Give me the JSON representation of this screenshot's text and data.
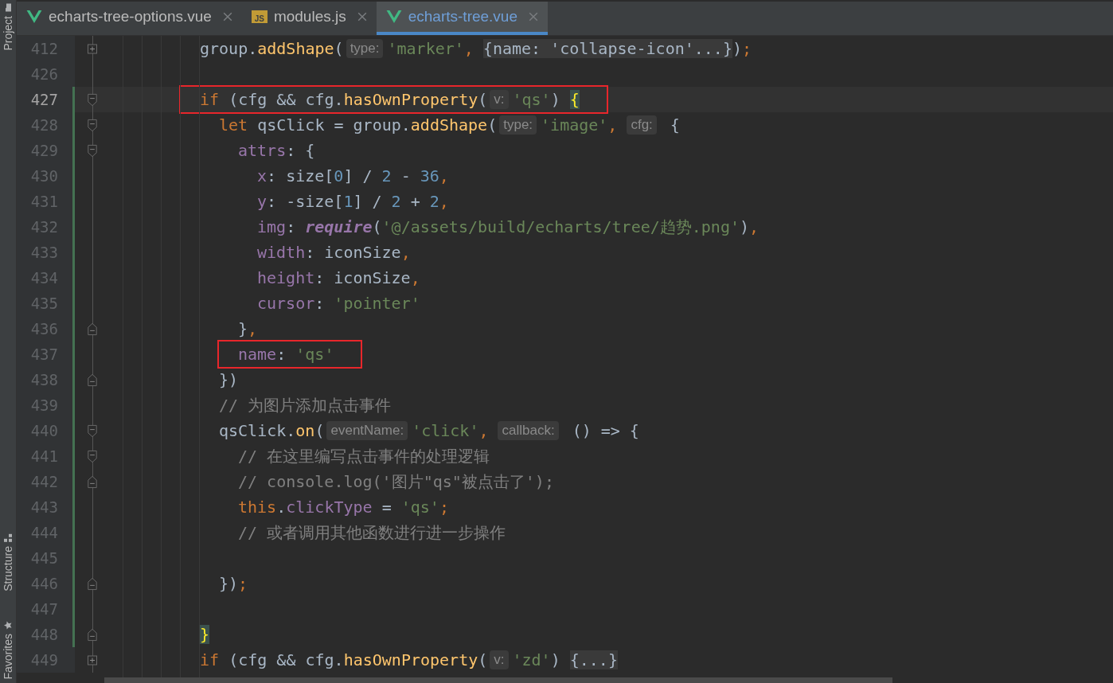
{
  "side_tabs": [
    {
      "label": "Project",
      "kind": "folder"
    },
    {
      "label": "Structure",
      "kind": "structure"
    },
    {
      "label": "Favorites",
      "kind": "star"
    }
  ],
  "tabs": [
    {
      "label": "echarts-tree-options.vue",
      "kind": "vue",
      "selected": false
    },
    {
      "label": "modules.js",
      "kind": "js",
      "icon_text": "JS",
      "selected": false
    },
    {
      "label": "echarts-tree.vue",
      "kind": "vue",
      "selected": true
    }
  ],
  "lines": [
    {
      "number": "412",
      "kind": "fold-plus",
      "changed": false,
      "current": false,
      "boxed": false,
      "tokens": [
        {
          "kind": "plain",
          "t": "group."
        },
        {
          "kind": "fn",
          "t": "addShape"
        },
        {
          "kind": "plain",
          "t": "("
        },
        {
          "kind": "hint",
          "t": "type:"
        },
        {
          "kind": "str",
          "t": "'marker'"
        },
        {
          "kind": "op",
          "t": ","
        },
        {
          "kind": "folded",
          "t": "{name: 'collapse-icon'...}"
        },
        {
          "kind": "plain",
          "t": ")"
        },
        {
          "kind": "op",
          "t": ";"
        }
      ]
    },
    {
      "number": "426",
      "changed": false,
      "current": false,
      "boxed": false
    },
    {
      "number": "427",
      "kind": "fold-open",
      "changed": true,
      "current": true,
      "boxed": true,
      "tokens": [
        {
          "kind": "kw",
          "t": "if"
        },
        {
          "kind": "plain",
          "t": " (cfg && cfg."
        },
        {
          "kind": "fn",
          "t": "hasOwnProperty"
        },
        {
          "kind": "plain",
          "t": "("
        },
        {
          "kind": "hint",
          "t": "v:"
        },
        {
          "kind": "str",
          "t": "'qs'"
        },
        {
          "kind": "plain",
          "t": ")"
        },
        {
          "kind": "brace",
          "t": "{"
        }
      ],
      "children": [
        {
          "number": "428",
          "kind": "fold-open",
          "changed": true,
          "current": false,
          "boxed": false,
          "tokens": [
            {
              "kind": "kw",
              "t": "let"
            },
            {
              "kind": "plain",
              "t": " qsClick = group."
            },
            {
              "kind": "fn",
              "t": "addShape"
            },
            {
              "kind": "plain",
              "t": "("
            },
            {
              "kind": "hint",
              "t": "type:"
            },
            {
              "kind": "str",
              "t": "'image'"
            },
            {
              "kind": "op",
              "t": ","
            },
            {
              "kind": "hint",
              "t": "cfg:"
            },
            {
              "kind": "plain",
              "t": "{"
            }
          ],
          "children": [
            {
              "number": "429",
              "kind": "fold-open",
              "changed": true,
              "current": false,
              "boxed": false,
              "tokens": [
                {
                  "kind": "prop",
                  "t": "attrs"
                },
                {
                  "kind": "plain",
                  "t": ": {"
                }
              ],
              "children": [
                {
                  "number": "430",
                  "changed": true,
                  "current": false,
                  "boxed": false,
                  "tokens": [
                    {
                      "kind": "prop",
                      "t": "x"
                    },
                    {
                      "kind": "plain",
                      "t": ": size["
                    },
                    {
                      "kind": "num",
                      "t": "0"
                    },
                    {
                      "kind": "plain",
                      "t": "] / "
                    },
                    {
                      "kind": "num",
                      "t": "2"
                    },
                    {
                      "kind": "plain",
                      "t": " - "
                    },
                    {
                      "kind": "num",
                      "t": "36"
                    },
                    {
                      "kind": "op",
                      "t": ","
                    }
                  ]
                },
                {
                  "number": "431",
                  "changed": true,
                  "current": false,
                  "boxed": false,
                  "tokens": [
                    {
                      "kind": "prop",
                      "t": "y"
                    },
                    {
                      "kind": "plain",
                      "t": ": -size["
                    },
                    {
                      "kind": "num",
                      "t": "1"
                    },
                    {
                      "kind": "plain",
                      "t": "] / "
                    },
                    {
                      "kind": "num",
                      "t": "2"
                    },
                    {
                      "kind": "plain",
                      "t": " + "
                    },
                    {
                      "kind": "num",
                      "t": "2"
                    },
                    {
                      "kind": "op",
                      "t": ","
                    }
                  ]
                },
                {
                  "number": "432",
                  "changed": true,
                  "current": false,
                  "boxed": false,
                  "tokens": [
                    {
                      "kind": "prop",
                      "t": "img"
                    },
                    {
                      "kind": "plain",
                      "t": ": "
                    },
                    {
                      "kind": "ital",
                      "t": "require"
                    },
                    {
                      "kind": "plain",
                      "t": "("
                    },
                    {
                      "kind": "str",
                      "t": "'@/assets/build/echarts/tree/趋势.png'"
                    },
                    {
                      "kind": "plain",
                      "t": ")"
                    },
                    {
                      "kind": "op",
                      "t": ","
                    }
                  ]
                },
                {
                  "number": "433",
                  "changed": true,
                  "current": false,
                  "boxed": false,
                  "tokens": [
                    {
                      "kind": "prop",
                      "t": "width"
                    },
                    {
                      "kind": "plain",
                      "t": ": iconSize"
                    },
                    {
                      "kind": "op",
                      "t": ","
                    }
                  ]
                },
                {
                  "number": "434",
                  "changed": true,
                  "current": false,
                  "boxed": false,
                  "tokens": [
                    {
                      "kind": "prop",
                      "t": "height"
                    },
                    {
                      "kind": "plain",
                      "t": ": iconSize"
                    },
                    {
                      "kind": "op",
                      "t": ","
                    }
                  ]
                },
                {
                  "number": "435",
                  "changed": true,
                  "current": false,
                  "boxed": false,
                  "tokens": [
                    {
                      "kind": "prop",
                      "t": "cursor"
                    },
                    {
                      "kind": "plain",
                      "t": ": "
                    },
                    {
                      "kind": "str",
                      "t": "'pointer'"
                    }
                  ]
                }
              ]
            },
            {
              "number": "436",
              "kind": "fold-close",
              "changed": true,
              "current": false,
              "boxed": false,
              "tokens": [
                {
                  "kind": "plain",
                  "t": "}"
                },
                {
                  "kind": "op",
                  "t": ","
                }
              ]
            },
            {
              "number": "437",
              "changed": true,
              "current": false,
              "boxed": true,
              "tokens": [
                {
                  "kind": "prop",
                  "t": "name"
                },
                {
                  "kind": "plain",
                  "t": ": "
                },
                {
                  "kind": "str",
                  "t": "'qs'"
                }
              ]
            }
          ]
        },
        {
          "number": "438",
          "kind": "fold-close",
          "changed": true,
          "current": false,
          "boxed": false,
          "tokens": [
            {
              "kind": "plain",
              "t": "})"
            }
          ]
        },
        {
          "number": "439",
          "changed": true,
          "current": false,
          "boxed": false,
          "tokens": [
            {
              "kind": "comment",
              "t": "// 为图片添加点击事件"
            }
          ]
        },
        {
          "number": "440",
          "kind": "fold-open",
          "changed": true,
          "current": false,
          "boxed": false,
          "tokens": [
            {
              "kind": "plain",
              "t": "qsClick."
            },
            {
              "kind": "fn",
              "t": "on"
            },
            {
              "kind": "plain",
              "t": "("
            },
            {
              "kind": "hint",
              "t": "eventName:"
            },
            {
              "kind": "str",
              "t": "'click'"
            },
            {
              "kind": "op",
              "t": ","
            },
            {
              "kind": "hint",
              "t": "callback:"
            },
            {
              "kind": "plain",
              "t": "() => {"
            }
          ],
          "children": [
            {
              "number": "441",
              "kind": "fold-open",
              "changed": true,
              "current": false,
              "boxed": false,
              "tokens": [
                {
                  "kind": "comment",
                  "t": "// 在这里编写点击事件的处理逻辑"
                }
              ]
            },
            {
              "number": "442",
              "kind": "fold-close",
              "changed": true,
              "current": false,
              "boxed": false,
              "tokens": [
                {
                  "kind": "comment",
                  "t": "// console.log('图片\"qs\"被点击了');"
                }
              ]
            },
            {
              "number": "443",
              "changed": true,
              "current": false,
              "boxed": false,
              "tokens": [
                {
                  "kind": "kw",
                  "t": "this"
                },
                {
                  "kind": "plain",
                  "t": "."
                },
                {
                  "kind": "prop",
                  "t": "clickType"
                },
                {
                  "kind": "plain",
                  "t": " = "
                },
                {
                  "kind": "str",
                  "t": "'qs'"
                },
                {
                  "kind": "op",
                  "t": ";"
                }
              ]
            },
            {
              "number": "444",
              "changed": true,
              "current": false,
              "boxed": false,
              "tokens": [
                {
                  "kind": "comment",
                  "t": "// 或者调用其他函数进行进一步操作"
                }
              ]
            },
            {
              "number": "445",
              "changed": true,
              "current": false,
              "boxed": false
            }
          ]
        },
        {
          "number": "446",
          "kind": "fold-close",
          "changed": true,
          "current": false,
          "boxed": false,
          "tokens": [
            {
              "kind": "plain",
              "t": "})"
            },
            {
              "kind": "op",
              "t": ";"
            }
          ]
        },
        {
          "number": "447",
          "changed": true,
          "current": false,
          "boxed": false
        }
      ]
    },
    {
      "number": "448",
      "kind": "fold-close",
      "changed": true,
      "current": false,
      "boxed": false,
      "tokens": [
        {
          "kind": "brace",
          "t": "}"
        }
      ]
    },
    {
      "number": "449",
      "kind": "fold-plus",
      "changed": false,
      "current": false,
      "boxed": false,
      "tokens": [
        {
          "kind": "kw",
          "t": "if"
        },
        {
          "kind": "plain",
          "t": " (cfg && cfg."
        },
        {
          "kind": "fn",
          "t": "hasOwnProperty"
        },
        {
          "kind": "plain",
          "t": "("
        },
        {
          "kind": "hint",
          "t": "v:"
        },
        {
          "kind": "str",
          "t": "'zd'"
        },
        {
          "kind": "plain",
          "t": ")"
        },
        {
          "kind": "folded",
          "t": "{...}"
        }
      ]
    }
  ]
}
